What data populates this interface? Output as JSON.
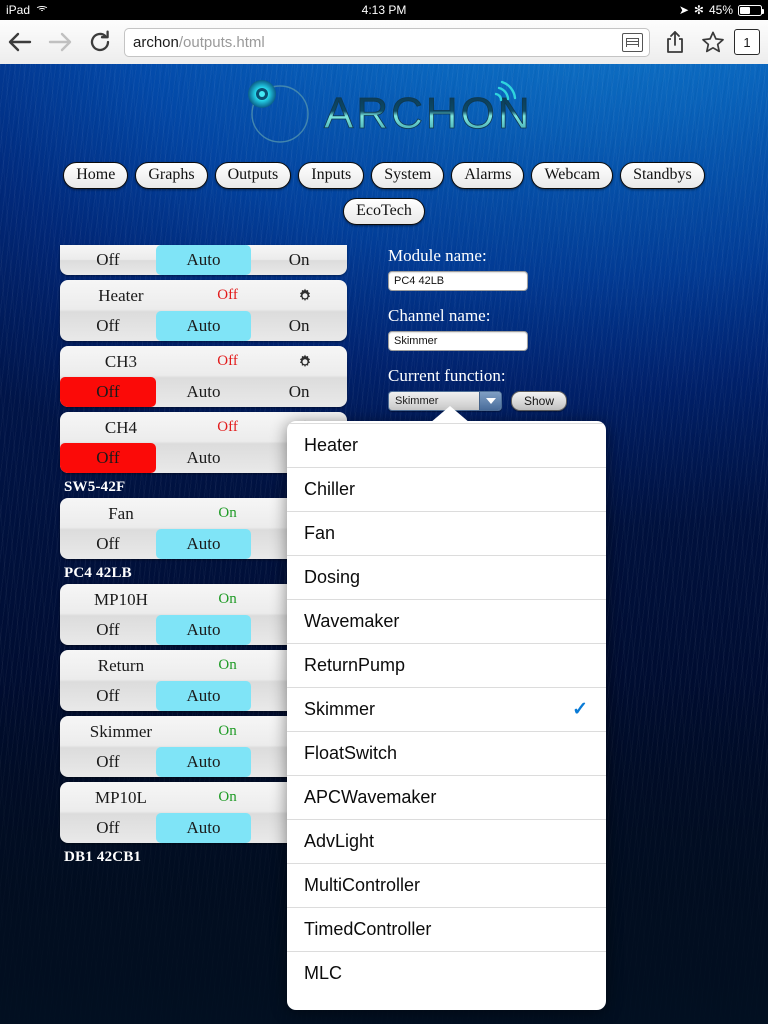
{
  "statusbar": {
    "carrier": "iPad",
    "wifi_icon": "wifi-icon",
    "time": "4:13 PM",
    "location_icon": "location-arrow-icon",
    "bluetooth_icon": "bluetooth-icon",
    "battery_pct": "45%"
  },
  "browser": {
    "back_icon": "back-arrow-icon",
    "forward_icon": "forward-arrow-icon",
    "reload_icon": "reload-icon",
    "url_host": "archon",
    "url_path": "/outputs.html",
    "reader_icon": "reader-view-icon",
    "share_icon": "share-icon",
    "bookmark_icon": "star-icon",
    "tab_count": "1"
  },
  "site": {
    "logo_text": "ARCHON",
    "nav_primary": [
      {
        "label": "Home"
      },
      {
        "label": "Graphs"
      },
      {
        "label": "Outputs"
      },
      {
        "label": "Inputs"
      },
      {
        "label": "System"
      },
      {
        "label": "Alarms"
      },
      {
        "label": "Webcam"
      },
      {
        "label": "Standbys"
      }
    ],
    "nav_secondary": [
      {
        "label": "EcoTech"
      }
    ]
  },
  "outputs": {
    "segment_labels": {
      "off": "Off",
      "auto": "Auto",
      "on": "On"
    },
    "gear_icon": "gear-icon",
    "groups": [
      {
        "header": null,
        "rows": [
          {
            "partial": true,
            "name": "",
            "state": "",
            "state_kind": "none",
            "gear": false,
            "selected": "auto"
          },
          {
            "partial": false,
            "name": "Heater",
            "state": "Off",
            "state_kind": "off",
            "gear": true,
            "selected": "auto"
          },
          {
            "partial": false,
            "name": "CH3",
            "state": "Off",
            "state_kind": "off",
            "gear": true,
            "selected": "off"
          },
          {
            "partial": false,
            "name": "CH4",
            "state": "Off",
            "state_kind": "off",
            "gear": true,
            "selected": "off"
          }
        ]
      },
      {
        "header": "SW5-42F",
        "rows": [
          {
            "partial": false,
            "name": "Fan",
            "state": "On",
            "state_kind": "on",
            "gear": true,
            "selected": "auto"
          }
        ]
      },
      {
        "header": "PC4 42LB",
        "rows": [
          {
            "partial": false,
            "name": "MP10H",
            "state": "On",
            "state_kind": "on",
            "gear": true,
            "selected": "auto"
          },
          {
            "partial": false,
            "name": "Return",
            "state": "On",
            "state_kind": "on",
            "gear": true,
            "selected": "auto"
          },
          {
            "partial": false,
            "name": "Skimmer",
            "state": "On",
            "state_kind": "on",
            "gear": true,
            "selected": "auto"
          },
          {
            "partial": false,
            "name": "MP10L",
            "state": "On",
            "state_kind": "on",
            "gear": true,
            "selected": "auto"
          }
        ]
      },
      {
        "header": "DB1 42CB1",
        "rows": []
      }
    ]
  },
  "form": {
    "module_label": "Module name:",
    "module_value": "PC4 42LB",
    "channel_label": "Channel name:",
    "channel_value": "Skimmer",
    "function_label": "Current function:",
    "function_value": "Skimmer",
    "dropdown_arrow_icon": "chevron-down-icon",
    "show_label": "Show"
  },
  "popover": {
    "check_icon": "checkmark-icon",
    "selected": "Skimmer",
    "items": [
      {
        "label": "Heater",
        "checked": false
      },
      {
        "label": "Chiller",
        "checked": false
      },
      {
        "label": "Fan",
        "checked": false
      },
      {
        "label": "Dosing",
        "checked": false
      },
      {
        "label": "Wavemaker",
        "checked": false
      },
      {
        "label": "ReturnPump",
        "checked": false
      },
      {
        "label": "Skimmer",
        "checked": true
      },
      {
        "label": "FloatSwitch",
        "checked": false
      },
      {
        "label": "APCWavemaker",
        "checked": false
      },
      {
        "label": "AdvLight",
        "checked": false
      },
      {
        "label": "MultiController",
        "checked": false
      },
      {
        "label": "TimedController",
        "checked": false
      },
      {
        "label": "MLC",
        "checked": false
      }
    ]
  },
  "colors": {
    "auto_selected": "#7fe4f7",
    "off_selected": "#fb0a08",
    "state_off": "#e21b1b",
    "state_on": "#1f9b26",
    "check": "#0a7bd6"
  }
}
